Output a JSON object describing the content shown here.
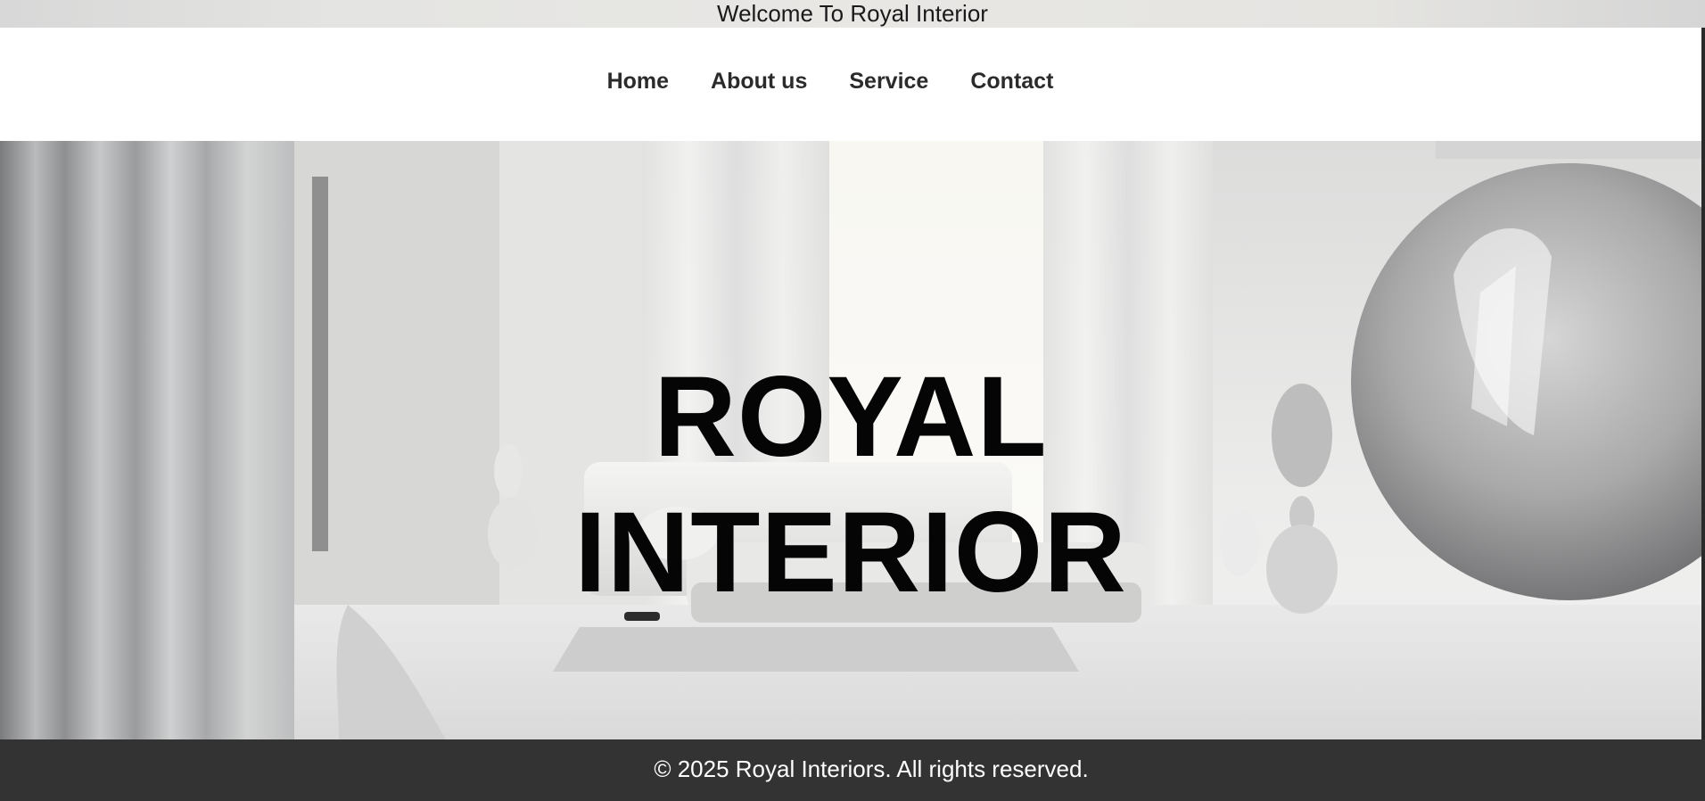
{
  "topbar": {
    "welcome_text": "Welcome To Royal Interior"
  },
  "nav": {
    "items": [
      {
        "label": "Home"
      },
      {
        "label": "About us"
      },
      {
        "label": "Service"
      },
      {
        "label": "Contact"
      }
    ]
  },
  "hero": {
    "title_line1": "ROYAL",
    "title_line2": "INTERIOR",
    "image_icon": "white-living-room-photo"
  },
  "footer": {
    "copyright": "© 2025 Royal Interiors. All rights reserved."
  },
  "colors": {
    "footer_bg": "#333333",
    "nav_text": "#2b2b2b",
    "hero_title": "#050505"
  }
}
